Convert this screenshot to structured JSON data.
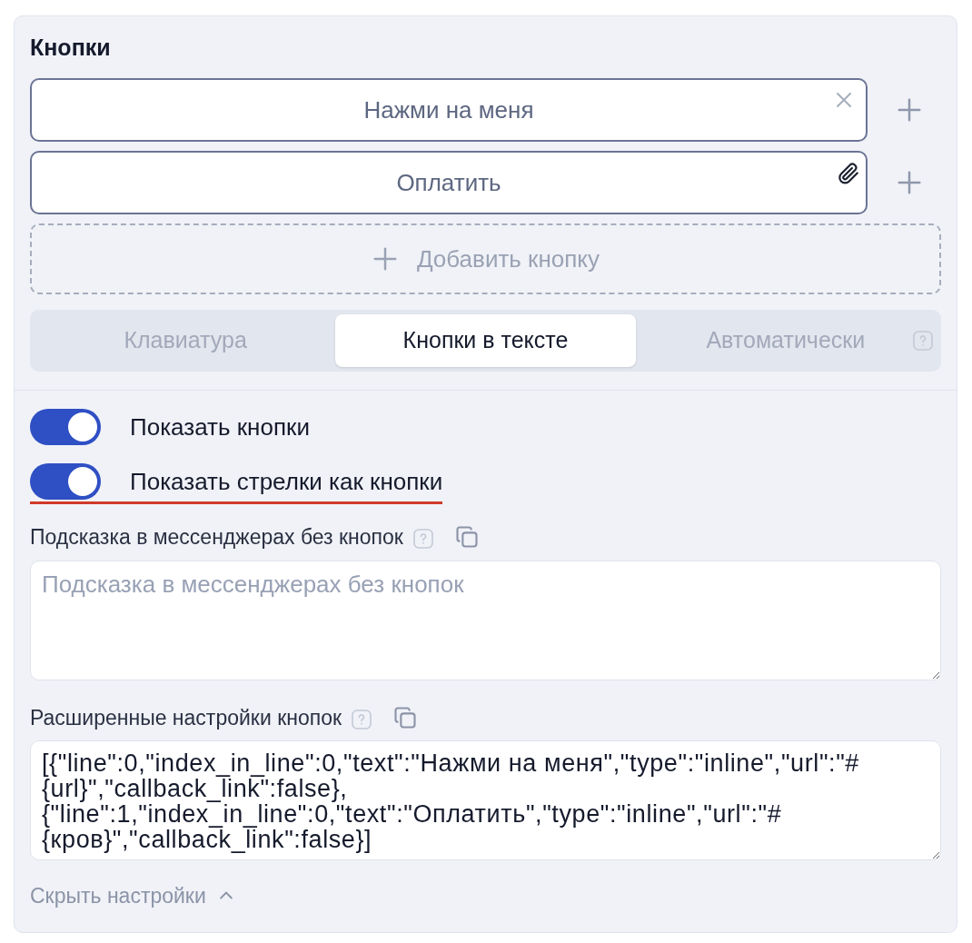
{
  "title": "Кнопки",
  "buttons": [
    {
      "label": "Нажми на меня",
      "kind": "removable"
    },
    {
      "label": "Оплатить",
      "kind": "attachment"
    }
  ],
  "add_button": "Добавить кнопку",
  "tabs": [
    {
      "label": "Клавиатура",
      "selected": false
    },
    {
      "label": "Кнопки в тексте",
      "selected": true
    },
    {
      "label": "Автоматически",
      "selected": false
    }
  ],
  "toggles": [
    {
      "label": "Показать кнопки",
      "on": true,
      "highlighted": false
    },
    {
      "label": "Показать стрелки как кнопки",
      "on": true,
      "highlighted": true
    }
  ],
  "hint_field": {
    "label": "Подсказка в мессенджерах без кнопок",
    "placeholder": "Подсказка в мессенджерах без кнопок"
  },
  "advanced_field": {
    "label": "Расширенные настройки кнопок",
    "value": "[{\"line\":0,\"index_in_line\":0,\"text\":\"Нажми на меня\",\"type\":\"inline\",\"url\":\"#{url}\",\"callback_link\":false},{\"line\":1,\"index_in_line\":0,\"text\":\"Оплатить\",\"type\":\"inline\",\"url\":\"#{кров}\",\"callback_link\":false}]"
  },
  "hide_link": "Скрыть настройки"
}
